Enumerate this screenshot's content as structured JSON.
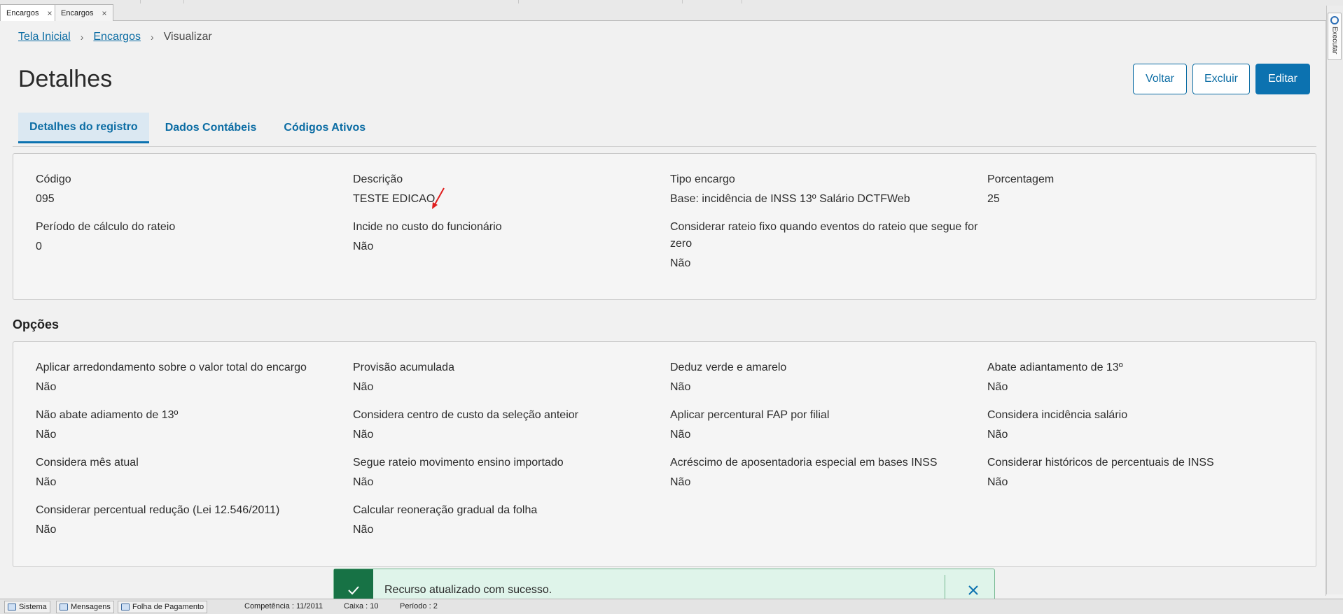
{
  "window_tabs": [
    {
      "label": "Encargos",
      "close": "×"
    },
    {
      "label": "Encargos",
      "close": "×"
    }
  ],
  "side_rail": {
    "label": "Executar"
  },
  "breadcrumb": {
    "home": "Tela Inicial",
    "section": "Encargos",
    "current": "Visualizar",
    "separator": "›"
  },
  "page_title": "Detalhes",
  "actions": {
    "back": "Voltar",
    "delete": "Excluir",
    "edit": "Editar"
  },
  "tabs": [
    "Detalhes do registro",
    "Dados Contábeis",
    "Códigos Ativos"
  ],
  "details": [
    {
      "label": "Código",
      "value": "095"
    },
    {
      "label": "Descrição",
      "value": "TESTE EDICAO"
    },
    {
      "label": "Tipo encargo",
      "value": "Base: incidência de INSS 13º Salário DCTFWeb"
    },
    {
      "label": "Porcentagem",
      "value": "25"
    },
    {
      "label": "Período de cálculo do rateio",
      "value": "0"
    },
    {
      "label": "Incide no custo do funcionário",
      "value": "Não"
    },
    {
      "label": "Considerar rateio fixo quando eventos do rateio que segue for zero",
      "value": "Não"
    }
  ],
  "options_title": "Opções",
  "options": [
    {
      "label": "Aplicar arredondamento sobre o valor total do encargo",
      "value": "Não"
    },
    {
      "label": "Provisão acumulada",
      "value": "Não"
    },
    {
      "label": "Deduz verde e amarelo",
      "value": "Não"
    },
    {
      "label": "Abate adiantamento de 13º",
      "value": "Não"
    },
    {
      "label": "Não abate adiamento de 13º",
      "value": "Não"
    },
    {
      "label": "Considera centro de custo da seleção anteior",
      "value": "Não"
    },
    {
      "label": "Aplicar percentural FAP por filial",
      "value": "Não"
    },
    {
      "label": "Considera incidência salário",
      "value": "Não"
    },
    {
      "label": "Considera mês atual",
      "value": "Não"
    },
    {
      "label": "Segue rateio movimento ensino importado",
      "value": "Não"
    },
    {
      "label": "Acréscimo de aposentadoria especial em bases INSS",
      "value": "Não"
    },
    {
      "label": "Considerar históricos de percentuais de INSS",
      "value": "Não"
    },
    {
      "label": "Considerar percentual redução (Lei 12.546/2011)",
      "value": "Não"
    },
    {
      "label": "Calcular reoneração gradual da folha",
      "value": "Não"
    }
  ],
  "toast": {
    "message": "Recurso atualizado com sucesso.",
    "status_color": "#177245"
  },
  "statusbar": {
    "sistema": "Sistema",
    "mensagens": "Mensagens",
    "folha": "Folha de Pagamento",
    "competencia": "Competência : 11/2011",
    "caixa": "Caixa : 10",
    "periodo": "Período : 2"
  },
  "colors": {
    "accent": "#0c72b0",
    "link": "#0c6da4",
    "annotation": "#e01e1e"
  }
}
